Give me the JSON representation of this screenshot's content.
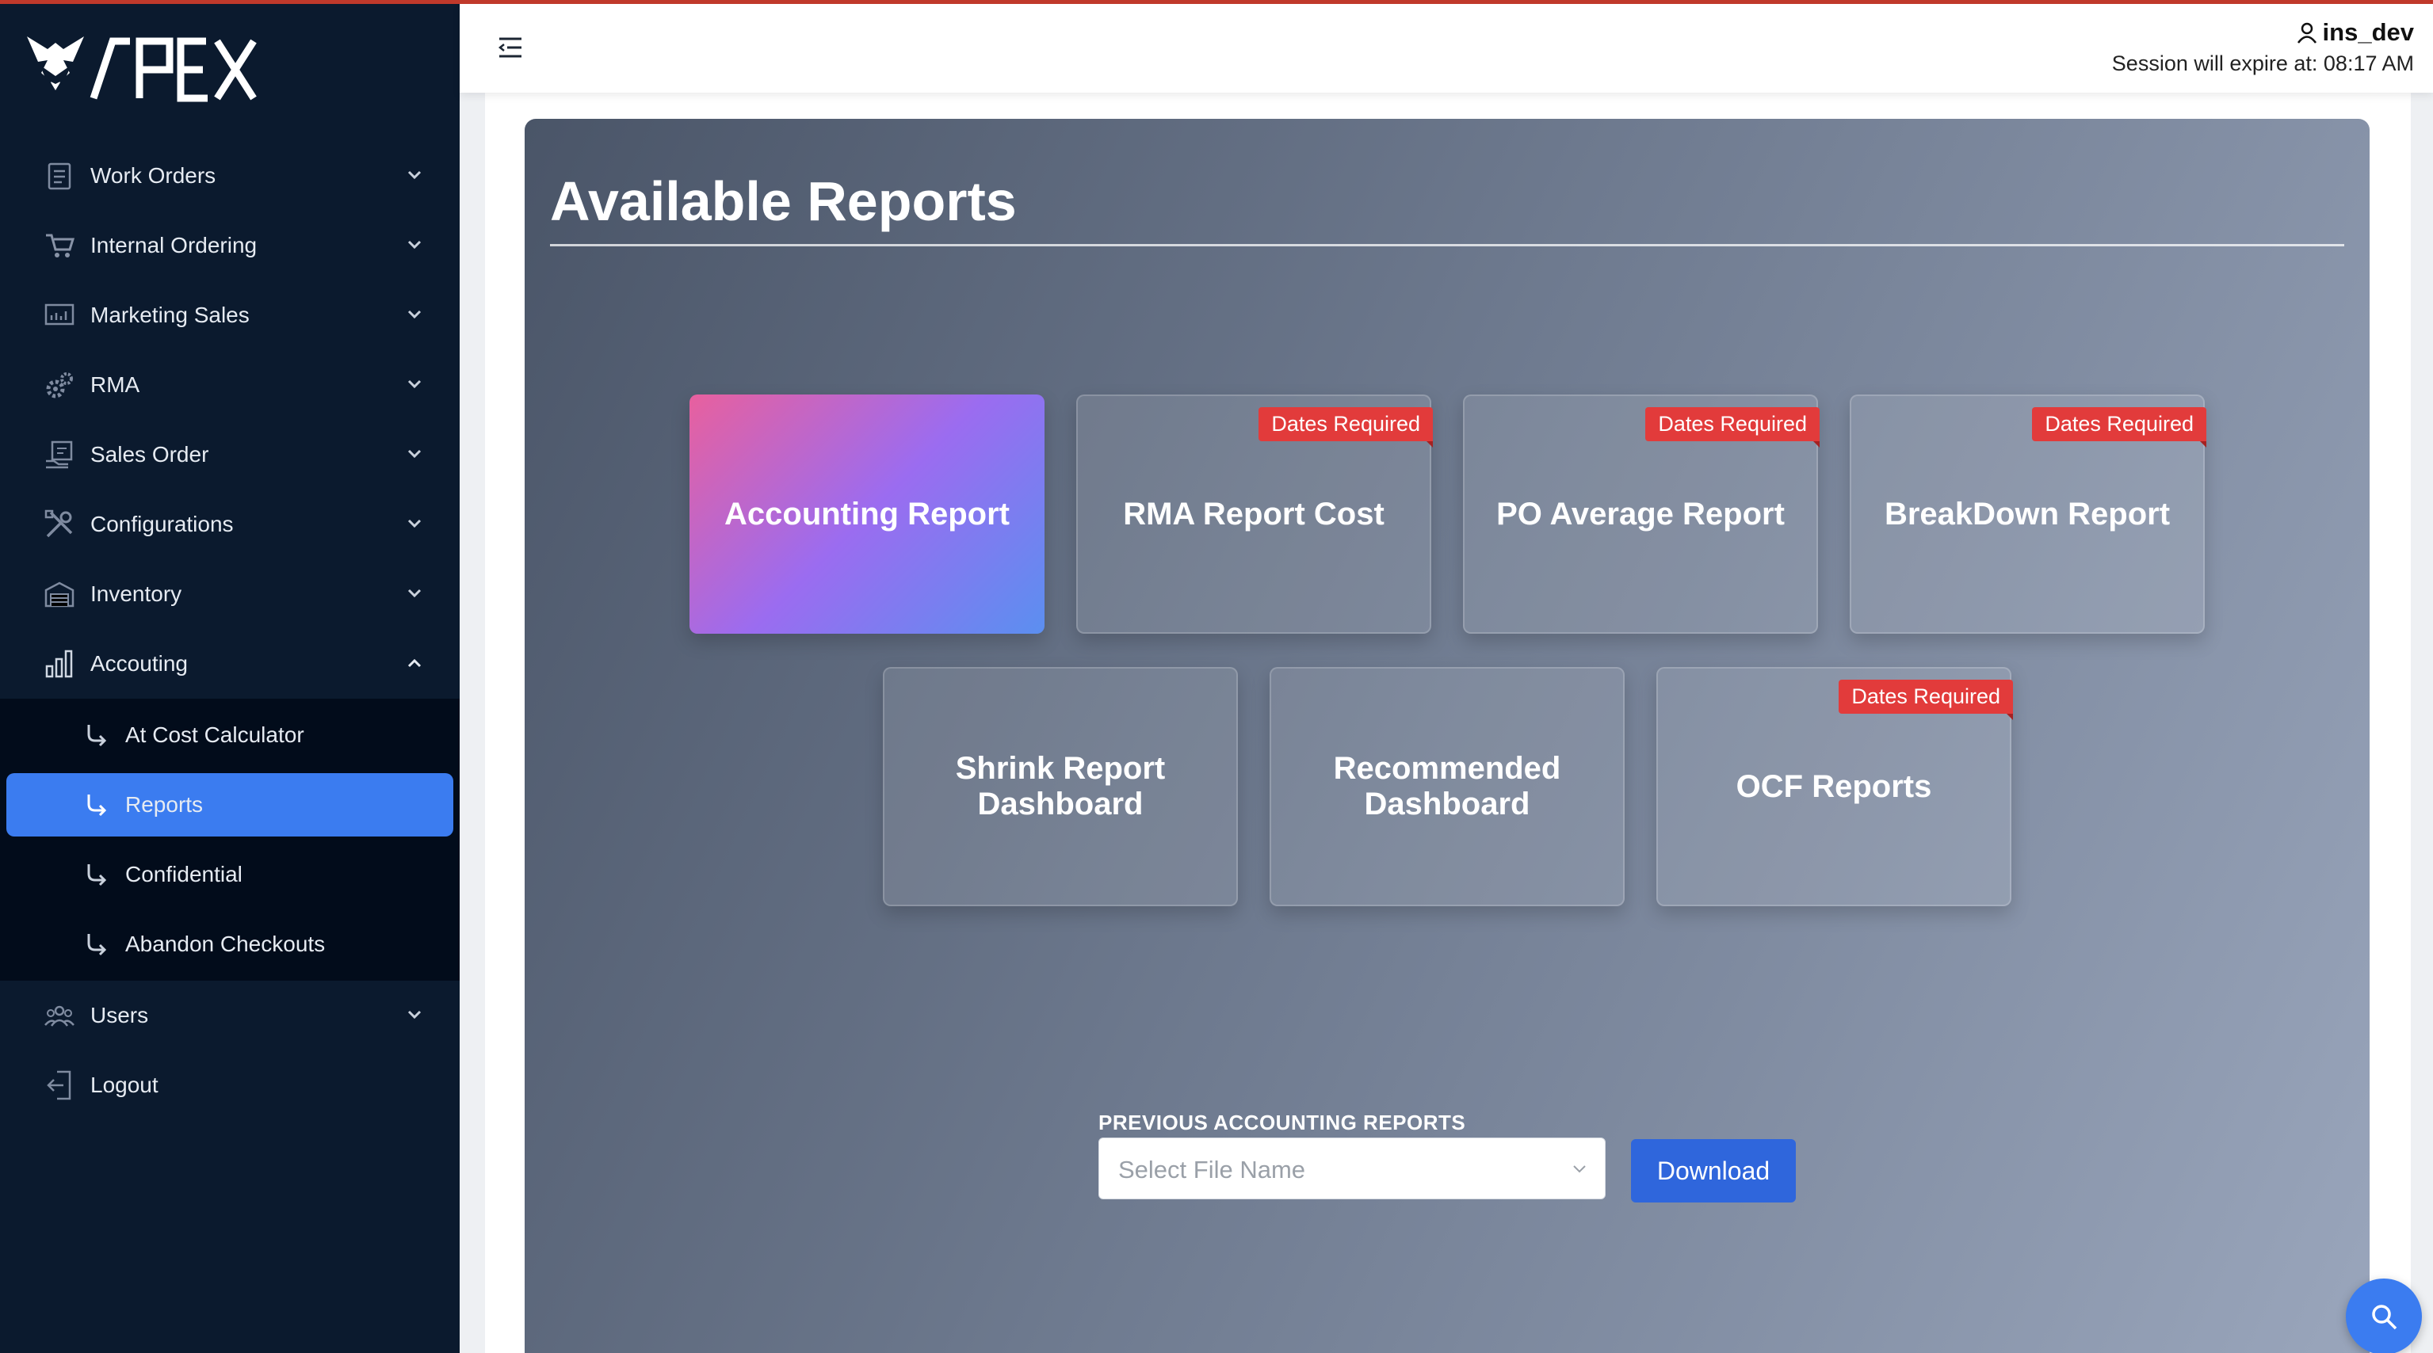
{
  "brand": {
    "logo_text": "APEX"
  },
  "sidebar": {
    "items": [
      {
        "label": "Work Orders",
        "icon": "clipboard-list-icon"
      },
      {
        "label": "Internal Ordering",
        "icon": "cart-icon"
      },
      {
        "label": "Marketing Sales",
        "icon": "chart-board-icon"
      },
      {
        "label": "RMA",
        "icon": "gears-icon"
      },
      {
        "label": "Sales Order",
        "icon": "sales-order-icon"
      },
      {
        "label": "Configurations",
        "icon": "tools-icon"
      },
      {
        "label": "Inventory",
        "icon": "warehouse-icon"
      },
      {
        "label": "Accouting",
        "icon": "bar-chart-icon"
      }
    ],
    "accounting_sub": [
      {
        "label": "At Cost Calculator"
      },
      {
        "label": "Reports"
      },
      {
        "label": "Confidential"
      },
      {
        "label": "Abandon Checkouts"
      }
    ],
    "bottom_items": [
      {
        "label": "Users",
        "icon": "users-icon"
      },
      {
        "label": "Logout",
        "icon": "logout-icon"
      }
    ],
    "active_sub": "Reports"
  },
  "topbar": {
    "username": "ins_dev",
    "session_text": "Session will expire at: 08:17 AM"
  },
  "main": {
    "title": "Available Reports",
    "cards": [
      {
        "title": "Accounting Report",
        "badge": "",
        "active": true
      },
      {
        "title": "RMA Report Cost",
        "badge": "Dates Required"
      },
      {
        "title": "PO Average Report",
        "badge": "Dates Required"
      },
      {
        "title": "BreakDown Report",
        "badge": "Dates Required"
      },
      {
        "title": "Shrink Report Dashboard",
        "badge": ""
      },
      {
        "title": "Recommended Dashboard",
        "badge": ""
      },
      {
        "title": "OCF Reports",
        "badge": "Dates Required"
      }
    ],
    "previous": {
      "label": "PREVIOUS ACCOUNTING REPORTS",
      "placeholder": "Select File Name",
      "download_label": "Download"
    }
  },
  "colors": {
    "sidebar_bg": "#0b1a2e",
    "active_blue": "#3b7cf0",
    "badge_red": "#e23b3b",
    "download_blue": "#2f66dc"
  }
}
